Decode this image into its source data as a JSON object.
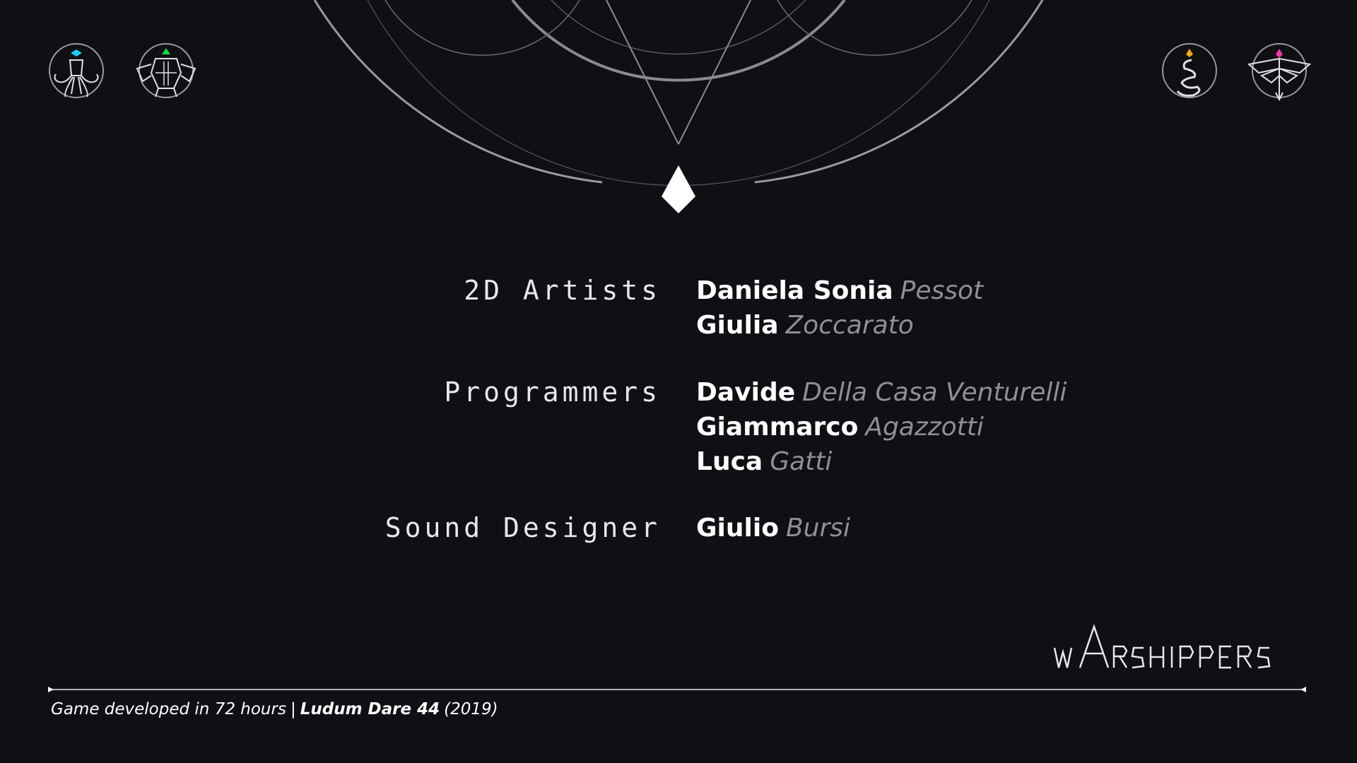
{
  "accent_colors": {
    "squid": "#1fc8f0",
    "turtle": "#17d64a",
    "snake": "#f5a815",
    "moth": "#f03aa8",
    "background": "#0f0f14",
    "surname": "#8f8f96"
  },
  "emblems": [
    {
      "icon": "squid-emblem-icon"
    },
    {
      "icon": "turtle-emblem-icon"
    },
    {
      "icon": "snake-emblem-icon"
    },
    {
      "icon": "moth-emblem-icon"
    }
  ],
  "credits": [
    {
      "role": "2D Artists",
      "people": [
        {
          "first": "Daniela Sonia",
          "last": "Pessot"
        },
        {
          "first": "Giulia",
          "last": "Zoccarato"
        }
      ]
    },
    {
      "role": "Programmers",
      "people": [
        {
          "first": "Davide",
          "last": "Della Casa Venturelli"
        },
        {
          "first": "Giammarco",
          "last": "Agazzotti"
        },
        {
          "first": "Luca",
          "last": "Gatti"
        }
      ]
    },
    {
      "role": "Sound Designer",
      "people": [
        {
          "first": "Giulio",
          "last": "Bursi"
        }
      ]
    }
  ],
  "wordmark": "wARSHIPPERS",
  "footer": {
    "lead": "Game developed in 72 hours",
    "separator": "|",
    "jam": "Ludum Dare 44",
    "year": "(2019)"
  }
}
